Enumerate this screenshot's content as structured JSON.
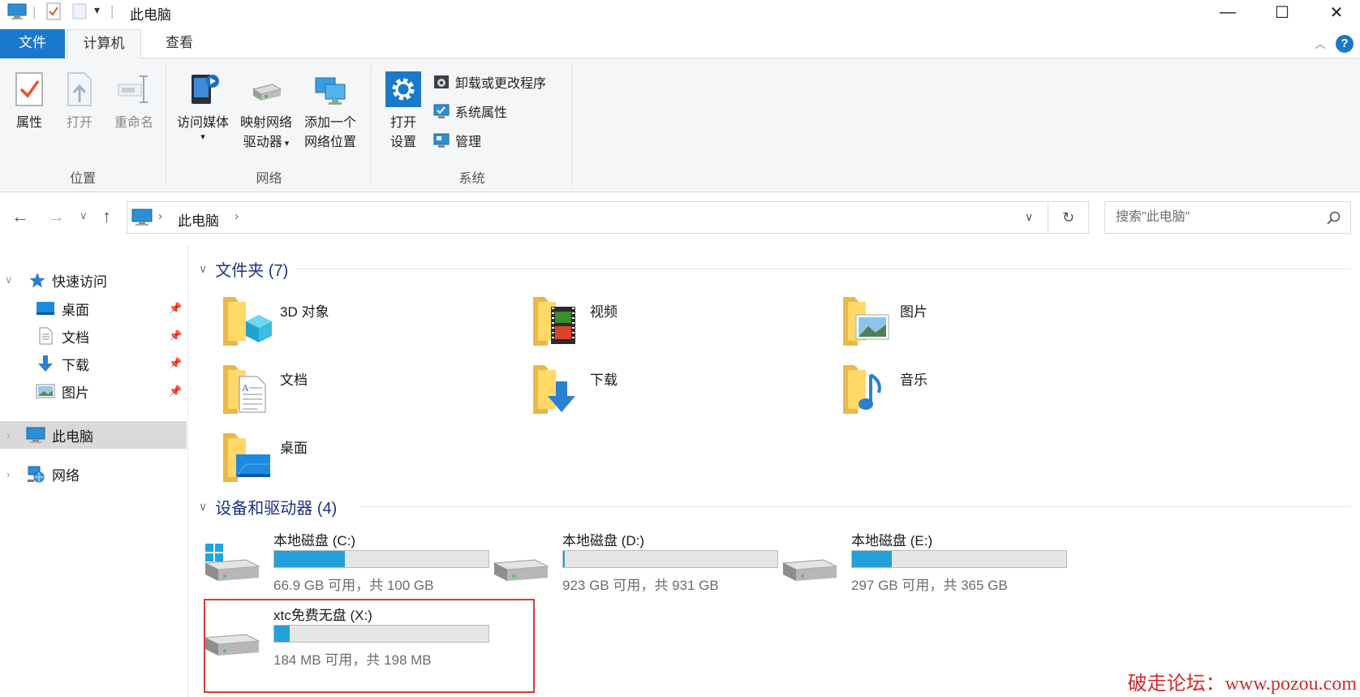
{
  "window": {
    "title": "此电脑",
    "minimize_glyph": "—",
    "maximize_glyph": "☐",
    "close_glyph": "✕"
  },
  "ribbon_tabs": {
    "file": "文件",
    "computer": "计算机",
    "view": "查看",
    "help": "?"
  },
  "ribbon": {
    "location": {
      "label": "位置",
      "properties": "属性",
      "open": "打开",
      "rename": "重命名"
    },
    "network": {
      "label": "网络",
      "access_media": "访问媒体",
      "map_drive_1": "映射网络",
      "map_drive_2": "驱动器",
      "add_location_1": "添加一个",
      "add_location_2": "网络位置"
    },
    "system": {
      "label": "系统",
      "open_settings_1": "打开",
      "open_settings_2": "设置",
      "uninstall": "卸载或更改程序",
      "system_properties": "系统属性",
      "manage": "管理"
    }
  },
  "address": {
    "path_item": "此电脑",
    "search_placeholder": "搜索\"此电脑\""
  },
  "nav_pane": {
    "quick_access": "快速访问",
    "items": [
      {
        "label": "桌面"
      },
      {
        "label": "文档"
      },
      {
        "label": "下载"
      },
      {
        "label": "图片"
      }
    ],
    "this_pc": "此电脑",
    "network": "网络"
  },
  "folders": {
    "header": "文件夹 (7)",
    "items": [
      {
        "label": "3D 对象",
        "icon": "3d-objects-folder-icon"
      },
      {
        "label": "视频",
        "icon": "videos-folder-icon"
      },
      {
        "label": "图片",
        "icon": "pictures-folder-icon"
      },
      {
        "label": "文档",
        "icon": "documents-folder-icon"
      },
      {
        "label": "下载",
        "icon": "downloads-folder-icon"
      },
      {
        "label": "音乐",
        "icon": "music-folder-icon"
      },
      {
        "label": "桌面",
        "icon": "desktop-folder-icon"
      }
    ]
  },
  "drives": {
    "header": "设备和驱动器 (4)",
    "items": [
      {
        "name": "本地磁盘 (C:)",
        "info": "66.9 GB 可用，共 100 GB",
        "used_fraction": 0.331
      },
      {
        "name": "本地磁盘 (D:)",
        "info": "923 GB 可用，共 931 GB",
        "used_fraction": 0.009
      },
      {
        "name": "本地磁盘 (E:)",
        "info": "297 GB 可用，共 365 GB",
        "used_fraction": 0.186
      },
      {
        "name": "xtc免费无盘 (X:)",
        "info": "184 MB 可用，共 198 MB",
        "used_fraction": 0.071
      }
    ]
  },
  "watermark": "破走论坛：www.pozou.com",
  "colors": {
    "accent": "#1979ca",
    "drive_bar": "#26a0da",
    "section_header": "#1e3287",
    "highlight_box": "#e0383b"
  }
}
